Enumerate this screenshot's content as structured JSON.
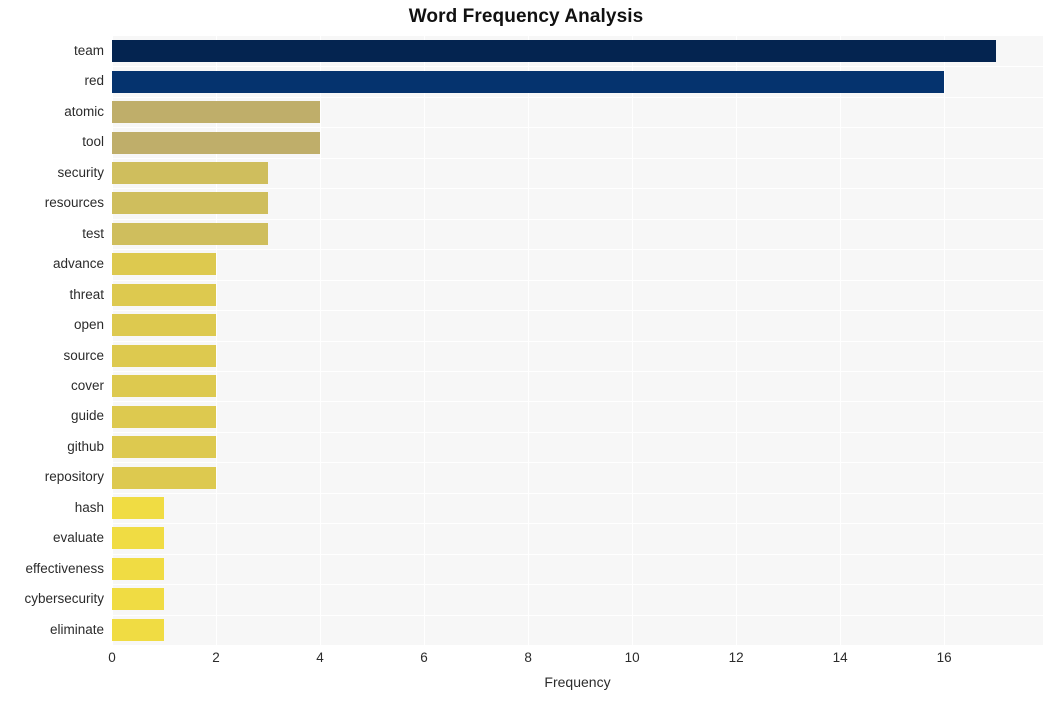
{
  "chart_data": {
    "type": "bar",
    "orientation": "horizontal",
    "title": "Word Frequency Analysis",
    "xlabel": "Frequency",
    "ylabel": "",
    "categories": [
      "team",
      "red",
      "atomic",
      "tool",
      "security",
      "resources",
      "test",
      "advance",
      "threat",
      "open",
      "source",
      "cover",
      "guide",
      "github",
      "repository",
      "hash",
      "evaluate",
      "effectiveness",
      "cybersecurity",
      "eliminate"
    ],
    "values": [
      17,
      16,
      4,
      4,
      3,
      3,
      3,
      2,
      2,
      2,
      2,
      2,
      2,
      2,
      2,
      1,
      1,
      1,
      1,
      1
    ],
    "bar_colors": [
      "#042450",
      "#05336e",
      "#bfae6a",
      "#bfae6a",
      "#cfbe5d",
      "#cfbe5d",
      "#cfbe5d",
      "#ddc94f",
      "#ddc94f",
      "#ddc94f",
      "#ddc94f",
      "#ddc94f",
      "#ddc94f",
      "#ddc94f",
      "#ddc94f",
      "#f0dc43",
      "#f0dc43",
      "#f0dc43",
      "#f0dc43",
      "#f0dc43"
    ],
    "xticks": [
      0,
      2,
      4,
      6,
      8,
      10,
      12,
      14,
      16
    ],
    "xtick_labels": [
      "0",
      "2",
      "4",
      "6",
      "8",
      "10",
      "12",
      "14",
      "16"
    ],
    "xlim": [
      0,
      17.9
    ],
    "grid": true,
    "grid_color": "#ffffff",
    "plot_background": "#f7f7f7",
    "figure_background": "#ffffff",
    "legend": null
  }
}
